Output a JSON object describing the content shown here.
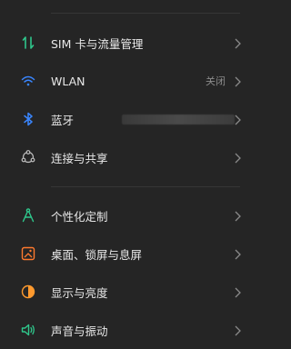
{
  "group1": [
    {
      "name": "sim-card-settings",
      "label": "SIM 卡与流量管理",
      "icon": "sim-arrows-icon",
      "color": "#2fc78c"
    },
    {
      "name": "wlan-settings",
      "label": "WLAN",
      "value": "关闭",
      "icon": "wifi-icon",
      "color": "#3a86ff"
    },
    {
      "name": "bluetooth-settings",
      "label": "蓝牙",
      "icon": "bluetooth-icon",
      "color": "#3a86ff"
    },
    {
      "name": "connection-sharing-settings",
      "label": "连接与共享",
      "icon": "share-nodes-icon",
      "color": "#bdbdbd"
    }
  ],
  "group2": [
    {
      "name": "personalization-settings",
      "label": "个性化定制",
      "icon": "compass-icon",
      "color": "#2fc78c"
    },
    {
      "name": "home-lock-screen-settings",
      "label": "桌面、锁屏与息屏",
      "icon": "wallpaper-icon",
      "color": "#ff7a2e"
    },
    {
      "name": "display-brightness-settings",
      "label": "显示与亮度",
      "icon": "brightness-icon",
      "color": "#ff9a2e"
    },
    {
      "name": "sound-vibration-settings",
      "label": "声音与振动",
      "icon": "speaker-icon",
      "color": "#2fc78c"
    }
  ]
}
